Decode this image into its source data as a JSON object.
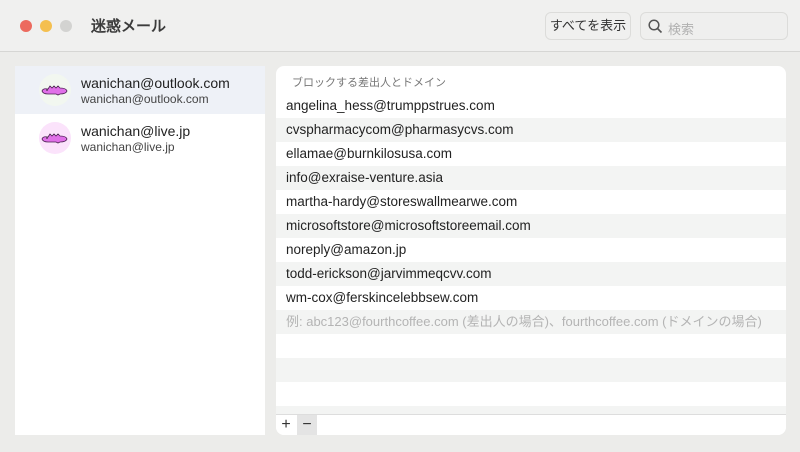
{
  "window": {
    "title": "迷惑メール",
    "show_all_label": "すべてを表示",
    "search_placeholder": "検索"
  },
  "accounts": [
    {
      "name": "wanichan@outlook.com",
      "email": "wanichan@outlook.com",
      "selected": true,
      "avatar_bg": "#f2f7f0"
    },
    {
      "name": "wanichan@live.jp",
      "email": "wanichan@live.jp",
      "selected": false,
      "avatar_bg": "#fbe3fb"
    }
  ],
  "blocked": {
    "header": "ブロックする差出人とドメイン",
    "items": [
      "angelina_hess@trumppstrues.com",
      "cvspharmacycom@pharmasycvs.com",
      "ellamae@burnkilosusa.com",
      "info@exraise-venture.asia",
      "martha-hardy@storeswallmearwe.com",
      "microsoftstore@microsoftstoreemail.com",
      "noreply@amazon.jp",
      "todd-erickson@jarvimmeqcvv.com",
      "wm-cox@ferskincelebbsew.com"
    ],
    "placeholder": "例: abc123@fourthcoffee.com (差出人の場合)、fourthcoffee.com (ドメインの場合)",
    "add_label": "+",
    "remove_label": "−"
  }
}
